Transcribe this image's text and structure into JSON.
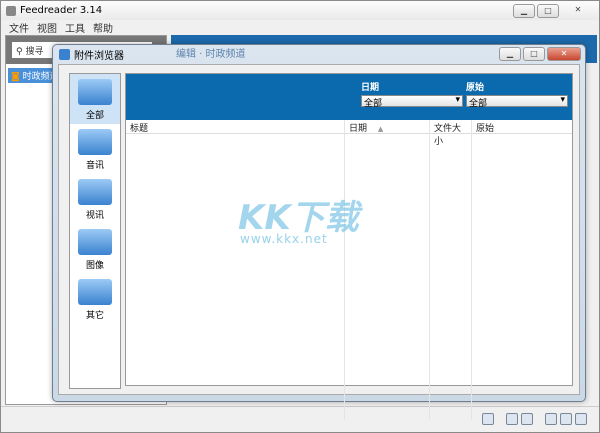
{
  "app": {
    "title": "Feedreader 3.14",
    "menu": [
      "文件",
      "视图",
      "工具",
      "帮助"
    ],
    "search_placeholder": "搜寻",
    "feed": "时政频道",
    "header": "编辑 · 时政频道"
  },
  "dialog": {
    "title": "附件浏览器",
    "categories": [
      "全部",
      "音讯",
      "视讯",
      "图像",
      "其它"
    ],
    "filters": {
      "date_label": "日期",
      "date_value": "全部",
      "source_label": "原始",
      "source_value": "全部"
    },
    "columns": [
      "标题",
      "日期",
      "文件大小",
      "原始"
    ],
    "sort_indicator": "▲"
  },
  "watermark": {
    "logo": "KK下载",
    "url": "www.kkx.net"
  },
  "colors": {
    "accent": "#0a6aad"
  }
}
